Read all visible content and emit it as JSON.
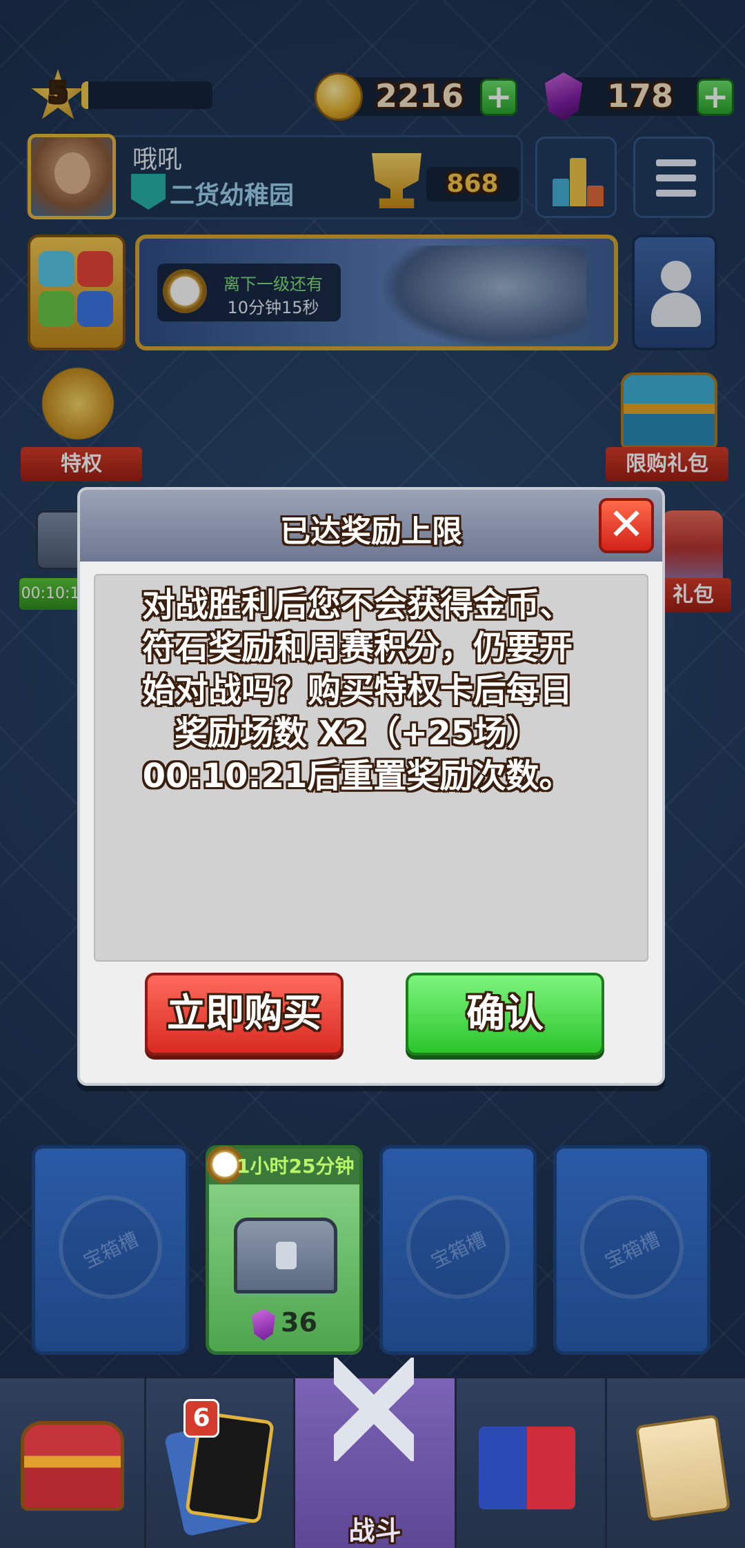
{
  "topbar": {
    "level": "5",
    "xp_progress": 0.05,
    "coins": "2216",
    "gems": "178",
    "coin_plus": "+",
    "gem_plus": "+"
  },
  "profile": {
    "player_name": "哦吼",
    "clan_name": "二货幼稚园",
    "trophies": "868"
  },
  "banner": {
    "timer_label": "离下一级还有",
    "timer_value": "10分钟15秒"
  },
  "side": {
    "privilege_label": "特权",
    "limited_pack_label": "限购礼包",
    "pack_label": "礼包",
    "left_timer": "00:10:1"
  },
  "dialog": {
    "title": "已达奖励上限",
    "close": "✕",
    "message_lines": [
      "对战胜利后您不会获得金币、",
      "符石奖励和周赛积分，仍要开",
      "始对战吗？购买特权卡后每日",
      "奖励场数 X2（+25场）",
      "00:10:21后重置奖励次数。"
    ],
    "buy_button": "立即购买",
    "confirm_button": "确认"
  },
  "slots": {
    "empty_label": "宝箱槽",
    "active_timer": "1小时25分钟",
    "active_cost": "36"
  },
  "nav": {
    "cards_badge": "6",
    "battle_label": "战斗"
  },
  "colors": {
    "gold": "#f5c84a",
    "buy_red": "#d82b22",
    "confirm_green": "#2bc52b",
    "gem_purple": "#7b1fa2"
  }
}
